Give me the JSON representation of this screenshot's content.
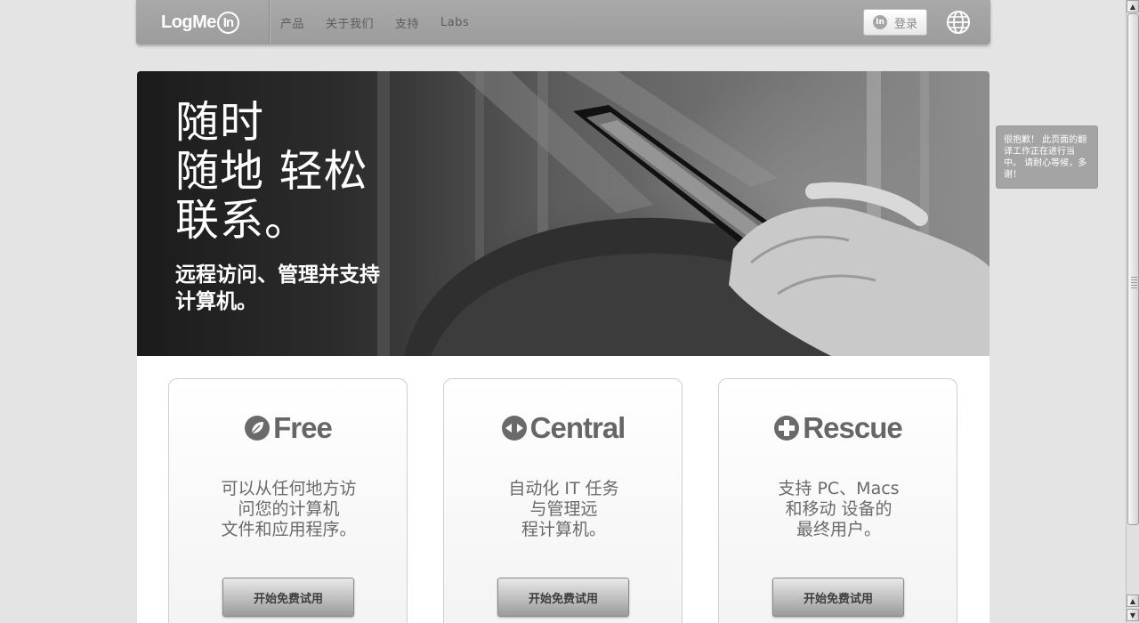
{
  "nav": {
    "logo_text": "LogMe",
    "logo_in": "In",
    "links": [
      "产品",
      "关于我们",
      "支持",
      "Labs"
    ],
    "login_icon": "In",
    "login_label": "登录",
    "language_icon": "globe-icon"
  },
  "hero": {
    "title": "随时\n随地 轻松\n联系。",
    "subtitle": "远程访问、管理并支持\n计算机。"
  },
  "products": [
    {
      "brand": "Free",
      "icon": "leaf-icon",
      "description": "可以从任何地方访\n问您的计算机\n文件和应用程序。",
      "cta": "开始免费试用"
    },
    {
      "brand": "Central",
      "icon": "arrows-icon",
      "description": "自动化 IT 任务\n与管理远\n程计算机。",
      "cta": "开始免费试用"
    },
    {
      "brand": "Rescue",
      "icon": "plus-icon",
      "description": "支持 PC、Macs\n和移动 设备的\n最终用户。",
      "cta": "开始免费试用"
    }
  ],
  "side_note": "很抱歉！ 此页面的翻译工作正在进行当中。 请耐心等候，多谢！"
}
